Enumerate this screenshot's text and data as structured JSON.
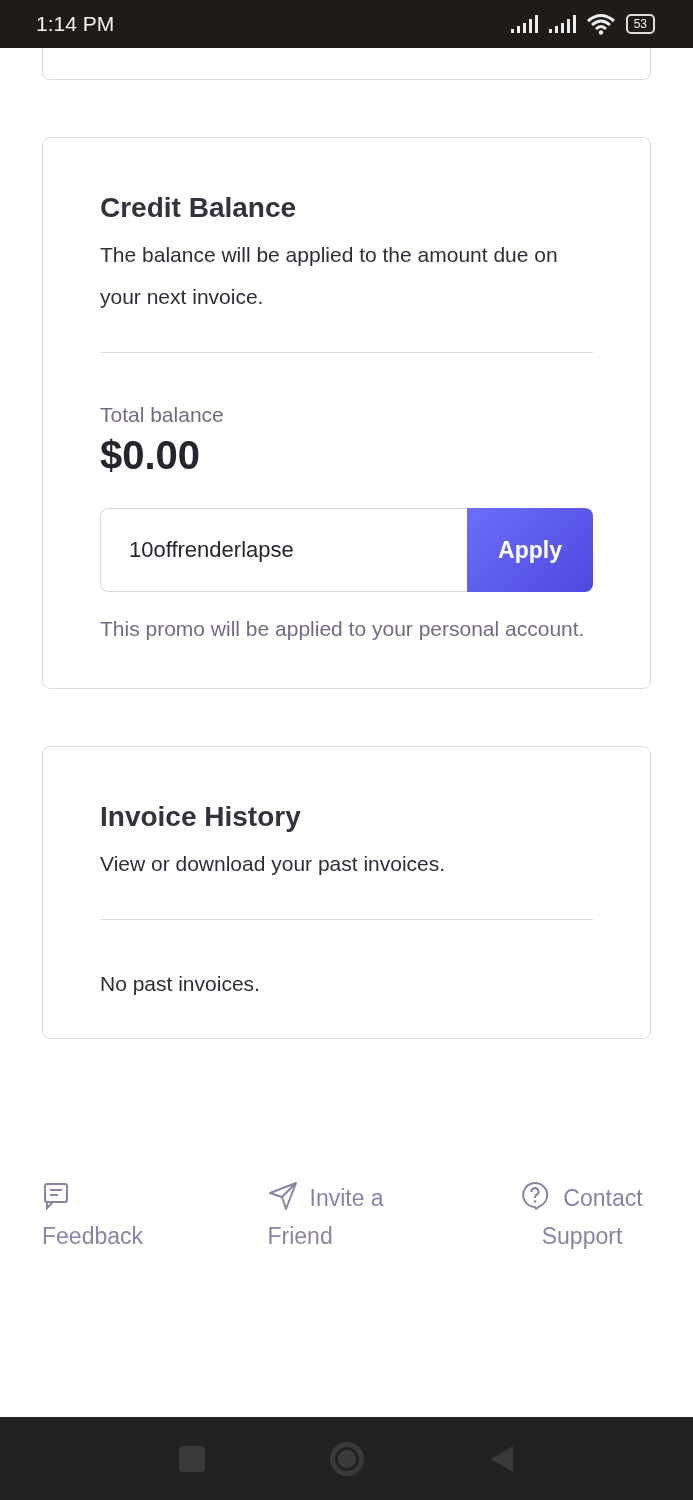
{
  "status_bar": {
    "time": "1:14 PM",
    "battery": "53"
  },
  "credit_balance": {
    "title": "Credit Balance",
    "description": "The balance will be applied to the amount due on your next invoice.",
    "total_label": "Total balance",
    "total_value": "$0.00",
    "promo_field": {
      "value": "10offrenderlapse"
    },
    "apply_button": "Apply",
    "promo_note": "This promo will be applied to your personal account."
  },
  "invoice_history": {
    "title": "Invoice History",
    "description": "View or download your past invoices.",
    "empty_message": "No past invoices."
  },
  "footer_links": [
    {
      "kind": "feedback",
      "label": "Feedback"
    },
    {
      "kind": "invite",
      "label": "Invite a Friend"
    },
    {
      "kind": "support",
      "label": "Contact Support"
    }
  ]
}
